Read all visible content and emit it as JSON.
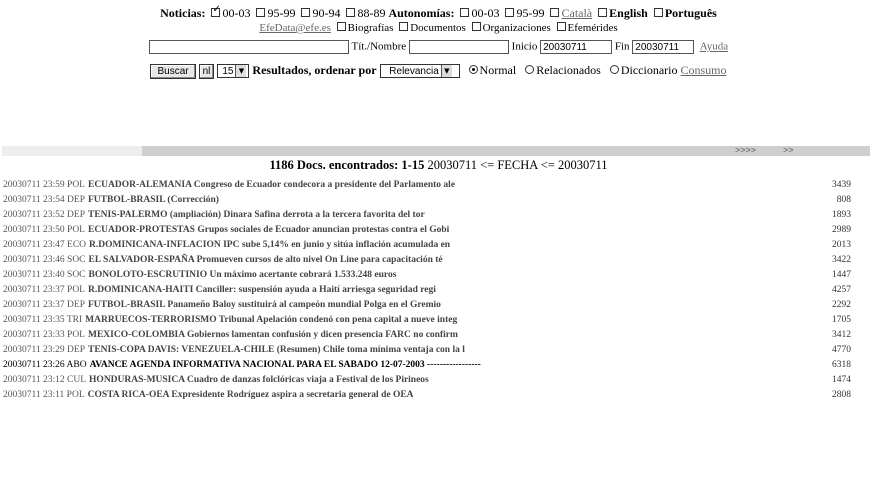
{
  "filters": {
    "noticias_label": "Noticias:",
    "noticias_options": [
      {
        "label": "00-03",
        "checked": true
      },
      {
        "label": "95-99",
        "checked": false
      },
      {
        "label": "90-94",
        "checked": false
      },
      {
        "label": "88-89",
        "checked": false
      }
    ],
    "autonomias_label": "Autonomías:",
    "autonomias_options": [
      {
        "label": "00-03",
        "checked": false
      },
      {
        "label": "95-99",
        "checked": false
      }
    ],
    "catala": "Català",
    "english": "English",
    "portugues": "Português",
    "efedata_link": "EfeData@efe.es",
    "sources": [
      "Biografías",
      "Documentos",
      "Organizaciones",
      "Efemérides"
    ]
  },
  "search": {
    "query_value": "",
    "tit_label": "Tít./Nombre",
    "tit_value": "",
    "inicio_label": "Inicio",
    "inicio_value": "20030711",
    "fin_label": "Fin",
    "fin_value": "20030711",
    "ayuda": "Ayuda"
  },
  "controls": {
    "buscar": "Buscar",
    "nl": "nl",
    "count_value": "15",
    "resultados_label": "Resultados, ordenar por",
    "order_value": "Relevancia",
    "radios": [
      {
        "label": "Normal",
        "checked": true
      },
      {
        "label": "Relacionados",
        "checked": false
      },
      {
        "label": "Diccionario",
        "checked": false
      }
    ],
    "consumo": "Consumo"
  },
  "nav": {
    "next": ">>>>",
    "last": ">>"
  },
  "summary": {
    "bold": "1186 Docs. encontrados: 1-15",
    "range": "20030711 <= FECHA <= 20030711"
  },
  "results": [
    {
      "meta": "20030711 23:59 POL",
      "title": "ECUADOR-ALEMANIA Congreso de Ecuador condecora a presidente del Parlamento ale",
      "size": "3439"
    },
    {
      "meta": "20030711 23:54 DEP",
      "title": "FUTBOL-BRASIL (Corrección)",
      "size": "808"
    },
    {
      "meta": "20030711 23:52 DEP",
      "title": "TENIS-PALERMO (ampliación) Dinara Safina derrota a la tercera favorita del tor",
      "size": "1893"
    },
    {
      "meta": "20030711 23:50 POL",
      "title": "ECUADOR-PROTESTAS Grupos sociales de Ecuador anuncian protestas contra el Gobi",
      "size": "2989"
    },
    {
      "meta": "20030711 23:47 ECO",
      "title": "R.DOMINICANA-INFLACION IPC sube 5,14% en junio y sitúa inflación acumulada en",
      "size": "2013"
    },
    {
      "meta": "20030711 23:46 SOC",
      "title": "EL SALVADOR-ESPAÑA Promueven cursos de alto nivel On Line para capacitación té",
      "size": "3422"
    },
    {
      "meta": "20030711 23:40 SOC",
      "title": "BONOLOTO-ESCRUTINIO Un máximo acertante cobrará 1.533.248 euros",
      "size": "1447"
    },
    {
      "meta": "20030711 23:37 POL",
      "title": "R.DOMINICANA-HAITI Canciller: suspensión ayuda a Haití arriesga seguridad regi",
      "size": "4257"
    },
    {
      "meta": "20030711 23:37 DEP",
      "title": "FUTBOL-BRASIL Panameño Baloy sustituirá al campeón mundial Polga en el Gremio",
      "size": "2292"
    },
    {
      "meta": "20030711 23:35 TRI",
      "title": "MARRUECOS-TERRORISMO Tribunal Apelación condenó con pena capital a nueve integ",
      "size": "1705"
    },
    {
      "meta": "20030711 23:33 POL",
      "title": "MEXICO-COLOMBIA Gobiernos lamentan confusión y dicen presencia FARC no confirm",
      "size": "3412"
    },
    {
      "meta": "20030711 23:29 DEP",
      "title": "TENIS-COPA DAVIS: VENEZUELA-CHILE (Resumen) Chile toma mínima ventaja con la l",
      "size": "4770"
    },
    {
      "meta": "20030711 23:26 ABO",
      "title": "AVANCE AGENDA INFORMATIVA NACIONAL PARA EL SABADO 12-07-2003 -----------------",
      "size": "6318",
      "highlight": true
    },
    {
      "meta": "20030711 23:12 CUL",
      "title": "HONDURAS-MUSICA Cuadro de danzas folclóricas viaja a Festival de los Pirineos",
      "size": "1474"
    },
    {
      "meta": "20030711 23:11 POL",
      "title": "COSTA RICA-OEA Expresidente Rodríguez aspira a secretaria general de OEA",
      "size": "2808"
    }
  ]
}
